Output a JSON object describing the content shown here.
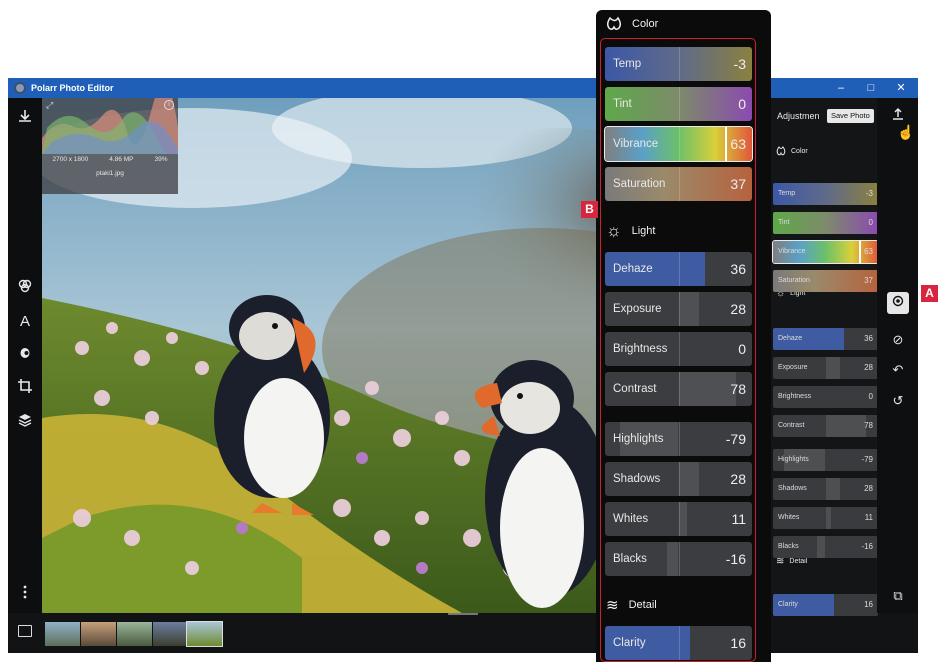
{
  "window": {
    "title": "Polarr Photo Editor",
    "controls": {
      "minimize": "–",
      "maximize": "□",
      "close": "✕"
    }
  },
  "histogram": {
    "resolution": "2700 x 1800",
    "megapixels": "4.86 MP",
    "zoom": "39%",
    "filename": "ptaki1.jpg"
  },
  "right_panel": {
    "title": "Adjustmen",
    "save_button": "Save Photo",
    "sections": {
      "color": "Color",
      "light": "Light",
      "detail": "Detail"
    }
  },
  "big_panel": {
    "sections": {
      "color": "Color",
      "light": "Light",
      "detail": "Detail"
    }
  },
  "sliders": [
    {
      "label": "Temp",
      "value": "-3",
      "level": -0.03
    },
    {
      "label": "Tint",
      "value": "0",
      "level": 0
    },
    {
      "label": "Vibrance",
      "value": "63",
      "level": 0.63
    },
    {
      "label": "Saturation",
      "value": "37",
      "level": 0.37
    },
    {
      "label": "Dehaze",
      "value": "36",
      "level": 0.36
    },
    {
      "label": "Exposure",
      "value": "28",
      "level": 0.28
    },
    {
      "label": "Brightness",
      "value": "0",
      "level": 0
    },
    {
      "label": "Contrast",
      "value": "78",
      "level": 0.78
    },
    {
      "label": "Highlights",
      "value": "-79",
      "level": -0.79
    },
    {
      "label": "Shadows",
      "value": "28",
      "level": 0.28
    },
    {
      "label": "Whites",
      "value": "11",
      "level": 0.11
    },
    {
      "label": "Blacks",
      "value": "-16",
      "level": -0.16
    },
    {
      "label": "Clarity",
      "value": "16",
      "level": 0.16
    }
  ],
  "callouts": {
    "a": "A",
    "b": "B"
  },
  "icons": {
    "left_toolbar": [
      "download-icon",
      "filters-icon",
      "text-icon",
      "retouch-icon",
      "crop-icon",
      "layers-icon",
      "more-icon"
    ],
    "right_sidebar": [
      "export-icon",
      "adjustments-icon",
      "compare-icon",
      "undo-history-icon",
      "reset-icon",
      "split-view-icon"
    ]
  },
  "colors": {
    "titlebar": "#1f5fb8",
    "callout": "#d7263d",
    "dehaze_fill": "#3f5ea8",
    "clarity_fill": "#3f5ea8"
  }
}
